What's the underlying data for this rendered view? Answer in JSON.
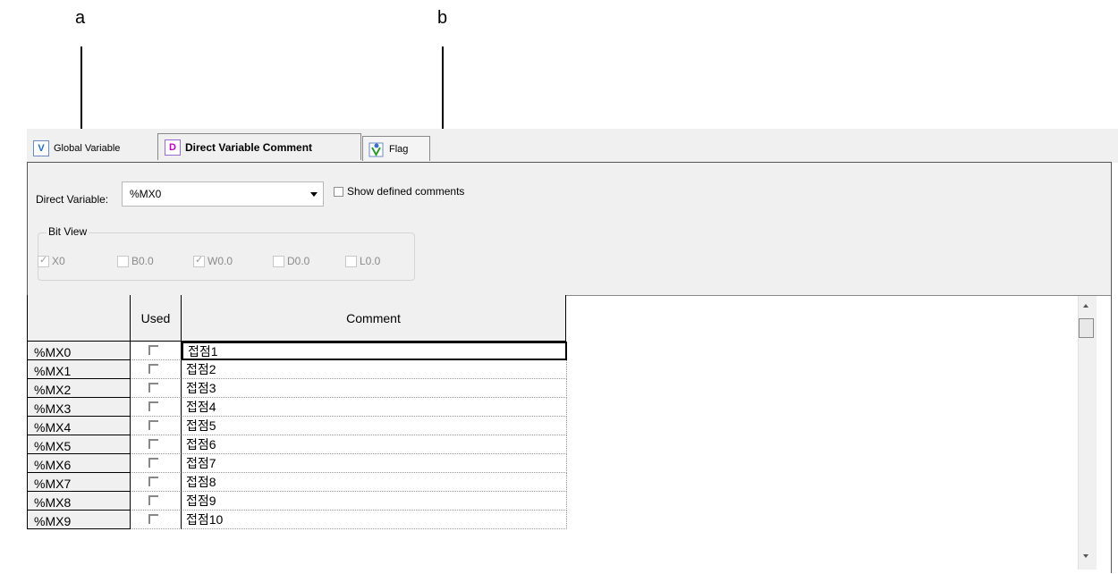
{
  "callouts": {
    "a": "a",
    "b": "b"
  },
  "tabs": {
    "global": {
      "icon": "V",
      "label": "Global Variable"
    },
    "direct": {
      "icon": "D",
      "label": "Direct Variable Comment"
    },
    "flag": {
      "label": "Flag"
    }
  },
  "direct_variable": {
    "label": "Direct Variable:",
    "value": "%MX0"
  },
  "show_defined": {
    "label": "Show defined comments",
    "checked": false
  },
  "bit_view": {
    "title": "Bit View",
    "items": [
      {
        "label": "X0",
        "checked": true
      },
      {
        "label": "B0.0",
        "checked": false
      },
      {
        "label": "W0.0",
        "checked": true
      },
      {
        "label": "D0.0",
        "checked": false
      },
      {
        "label": "L0.0",
        "checked": false
      }
    ]
  },
  "table": {
    "headers": {
      "name": "",
      "used": "Used",
      "comment": "Comment"
    },
    "rows": [
      {
        "name": "%MX0",
        "comment": "접점1"
      },
      {
        "name": "%MX1",
        "comment": "접점2"
      },
      {
        "name": "%MX2",
        "comment": "접점3"
      },
      {
        "name": "%MX3",
        "comment": "접점4"
      },
      {
        "name": "%MX4",
        "comment": "접점5"
      },
      {
        "name": "%MX5",
        "comment": "접점6"
      },
      {
        "name": "%MX6",
        "comment": "접점7"
      },
      {
        "name": "%MX7",
        "comment": "접점8"
      },
      {
        "name": "%MX8",
        "comment": "접점9"
      },
      {
        "name": "%MX9",
        "comment": "접점10"
      }
    ]
  }
}
